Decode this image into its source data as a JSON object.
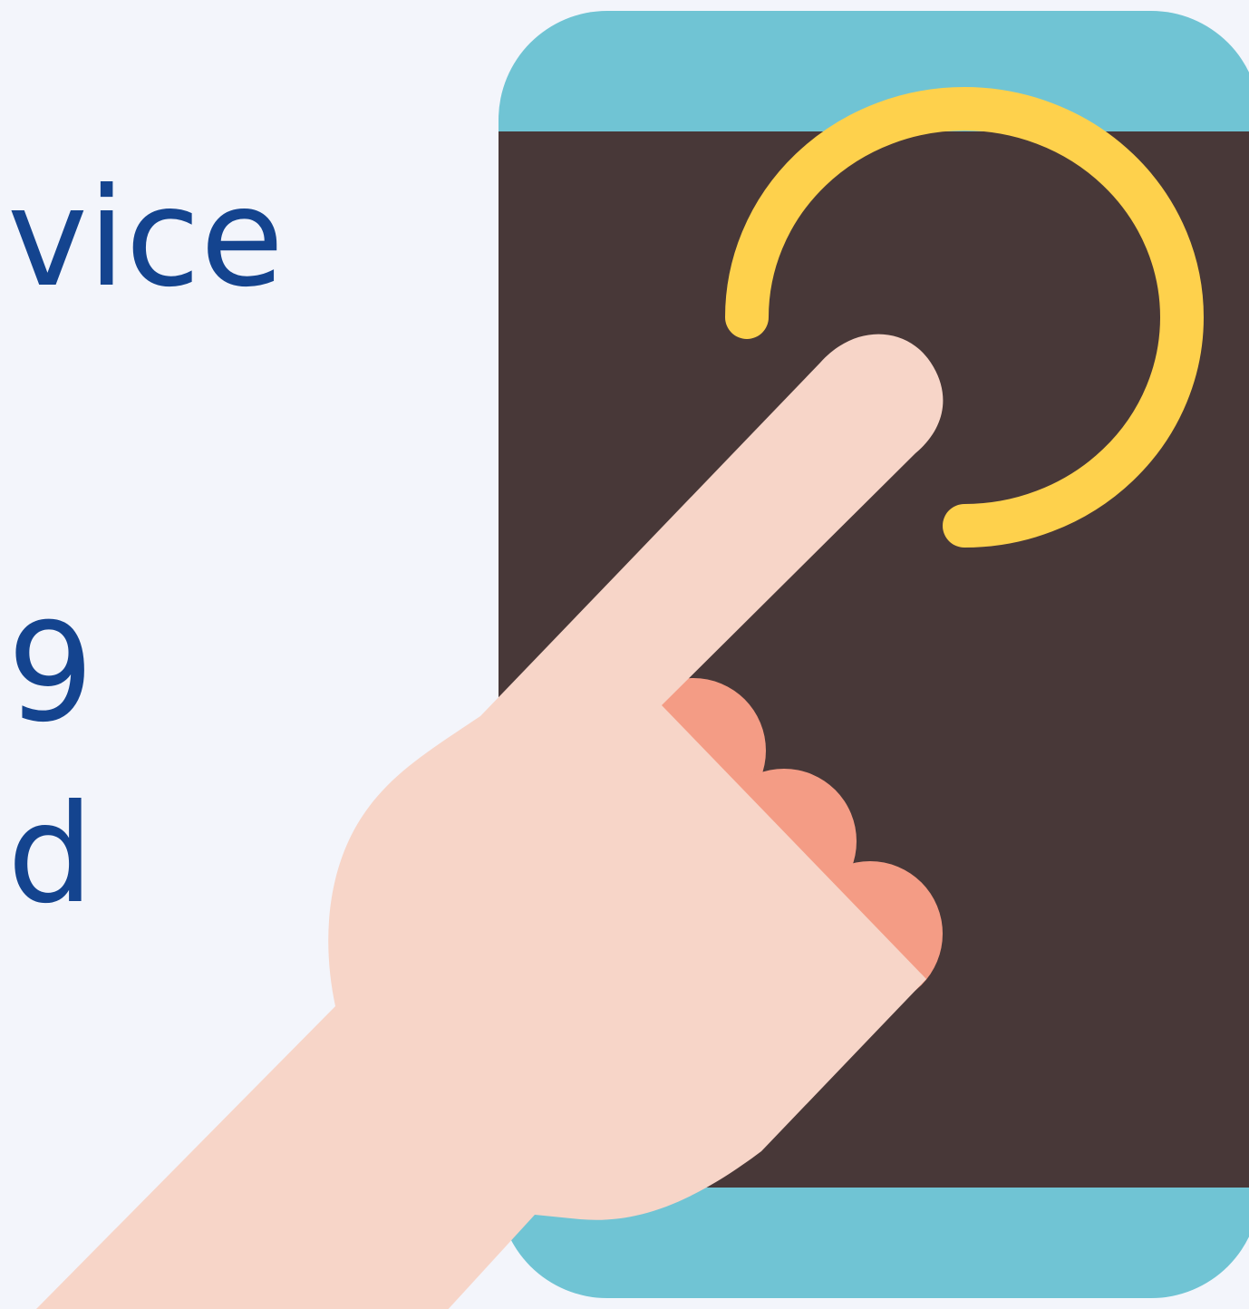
{
  "fragments": {
    "line1": "vice",
    "line2": "9",
    "line3": "d"
  },
  "illustration": {
    "icon": "smartphone-tap-icon",
    "colors": {
      "background": "#f3f5fb",
      "text": "#14448f",
      "phone_frame": "#70c4d4",
      "phone_screen": "#483838",
      "tap_arc": "#fed14c",
      "hand": "#f7d5c8",
      "knuckles": "#f49c85"
    }
  }
}
